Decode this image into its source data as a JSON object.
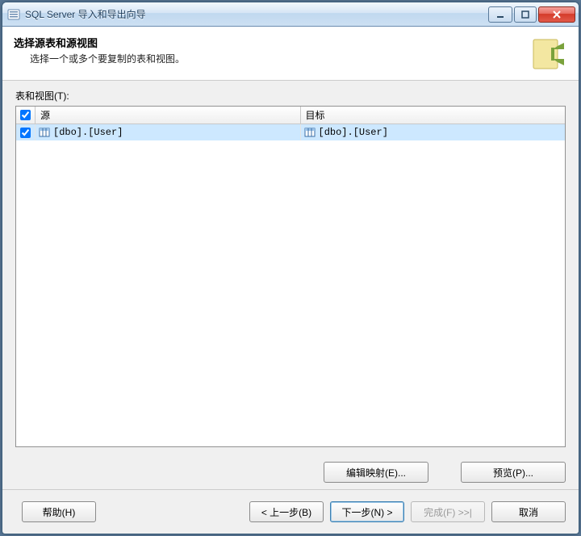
{
  "window": {
    "title": "SQL Server 导入和导出向导"
  },
  "header": {
    "title": "选择源表和源视图",
    "subtitle": "选择一个或多个要复制的表和视图。"
  },
  "content": {
    "tables_label": "表和视图(T):",
    "columns": {
      "source": "源",
      "target": "目标"
    },
    "rows": [
      {
        "checked": true,
        "source": "[dbo].[User]",
        "target": "[dbo].[User]"
      }
    ]
  },
  "buttons": {
    "edit_mapping": "编辑映射(E)...",
    "preview": "预览(P)...",
    "help": "帮助(H)",
    "back": "< 上一步(B)",
    "next": "下一步(N) >",
    "finish": "完成(F) >>|",
    "cancel": "取消"
  }
}
